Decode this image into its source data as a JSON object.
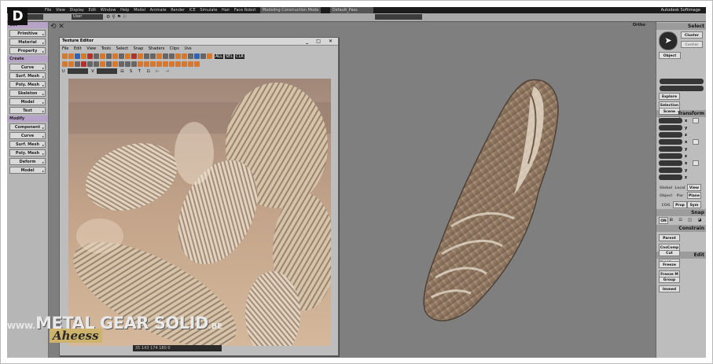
{
  "badge": "D",
  "menubar": {
    "items": [
      "File",
      "View",
      "Display",
      "Edit",
      "Window",
      "Help",
      "Model",
      "Animate",
      "Render",
      "ICE",
      "Simulate",
      "Hair",
      "Face Robot"
    ],
    "construction_mode": "Modeling Construction Mode",
    "pass": "Default_Pass",
    "brand": "Autodesk Softimage"
  },
  "toolbar": {
    "layer": "User"
  },
  "viewport": {
    "label": "Ortho"
  },
  "left_panel": {
    "sections": [
      {
        "title": "Get",
        "buttons": [
          "Primitive",
          "Material",
          "Property"
        ]
      },
      {
        "title": "Create",
        "buttons": [
          "Curve",
          "Surf. Mesh",
          "Poly. Mesh",
          "Skeleton",
          "Model",
          "Text"
        ]
      },
      {
        "title": "Modify",
        "buttons": [
          "Component",
          "Curve",
          "Surf. Mesh",
          "Poly. Mesh",
          "Deform",
          "Model"
        ]
      }
    ]
  },
  "texture_editor": {
    "title": "Texture Editor",
    "menu": [
      "File",
      "Edit",
      "View",
      "Tools",
      "Select",
      "Snap",
      "Shaders",
      "Clips",
      "Uvs"
    ],
    "coord_labels": [
      "U",
      "V"
    ],
    "tool_labels": [
      "ALL",
      "SEL",
      "CLR"
    ]
  },
  "right_panel": {
    "select": {
      "header": "Select",
      "buttons": [
        "Cluster",
        "Center",
        "Object"
      ],
      "explore": "Explore",
      "scene": "Scene",
      "selection": "Selection",
      "clusters": "Clusters"
    },
    "transform": {
      "header": "Transform",
      "axes": [
        "x",
        "y",
        "z"
      ],
      "modes": [
        "Global",
        "Local",
        "View",
        "Object",
        "Par",
        "Plane",
        "COG",
        "Prop",
        "Sym"
      ]
    },
    "snap": {
      "header": "Snap",
      "on_label": "ON"
    },
    "constrain": {
      "header": "Constrain",
      "buttons": [
        "Parent",
        "Cut",
        "CnsComp",
        "ChldComp"
      ]
    },
    "edit": {
      "header": "Edit",
      "buttons": [
        "Freeze",
        "Group",
        "Freeze M",
        "Immed"
      ]
    }
  },
  "statusbar": {
    "text": "35 143 174 180 0"
  },
  "watermark": {
    "main": "METAL GEAR SOLID",
    "site": ".BE",
    "prefix": "WWW.",
    "sub": "Aheess"
  },
  "colors": {
    "viewport_bg": "#7f7f7f",
    "section_header": "#b7a2c8",
    "panel_bg": "#b6b6b6"
  }
}
